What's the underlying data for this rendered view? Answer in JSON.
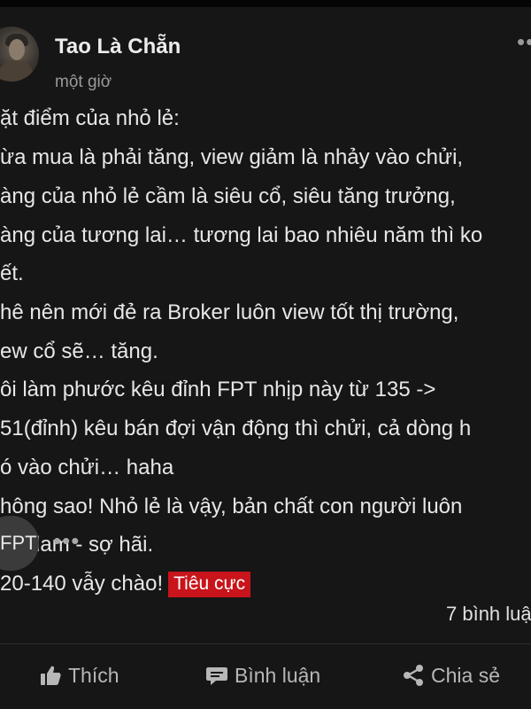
{
  "post": {
    "author": "Tao Là Chẵn",
    "time": "một giờ",
    "lines": [
      "ặt điểm của nhỏ lẻ:",
      "ừa mua là phải tăng, view giảm là nhảy vào chửi,",
      "àng của nhỏ lẻ cầm là siêu cổ, siêu tăng trưởng,",
      "àng của tương lai… tương lai bao nhiêu năm thì ko",
      "ết.",
      "hê nên mới đẻ ra Broker luôn view tốt thị trường,",
      "ew cổ sẽ… tăng.",
      "ôi làm phước kêu đỉnh FPT nhịp này từ 135 ->",
      "51(đỉnh) kêu bán đợi vận động thì chửi, cả dòng h",
      "ó vào chửi… haha",
      "hông sao! Nhỏ lẻ là vậy, bản chất con người luôn",
      "am lam - sợ hãi."
    ],
    "last_line": "20-140 vẫy chào!",
    "sentiment_tag": "Tiêu cực",
    "stock_chip": "FPT",
    "comment_count": "7 bình luậ",
    "actions": {
      "like": "Thích",
      "comment": "Bình luận",
      "share": "Chia sẻ"
    }
  },
  "colors": {
    "background": "#161616",
    "tag": "#c8141a",
    "chip": "#3b3b3b"
  },
  "icons": {
    "more_top": "more-horizontal-icon",
    "more_inline": "more-horizontal-icon",
    "like": "thumbs-up-icon",
    "comment": "comment-bubble-icon",
    "share": "share-icon"
  }
}
